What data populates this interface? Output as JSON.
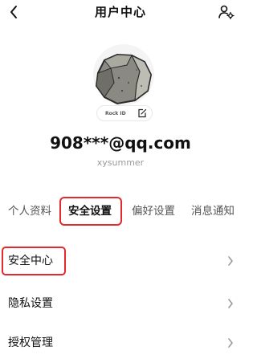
{
  "header": {
    "title": "用户中心",
    "back_icon": "chevron-left-icon",
    "action_icon": "user-settings-icon"
  },
  "profile": {
    "avatar_label": "Rock ID",
    "edit_icon": "edit-icon",
    "email": "908***@qq.com",
    "nickname": "xysummer"
  },
  "tabs": [
    {
      "label": "个人资料",
      "active": false
    },
    {
      "label": "安全设置",
      "active": true
    },
    {
      "label": "偏好设置",
      "active": false
    },
    {
      "label": "消息通知",
      "active": false
    }
  ],
  "rows": [
    {
      "label": "安全中心"
    },
    {
      "label": "隐私设置"
    },
    {
      "label": "授权管理"
    }
  ],
  "colors": {
    "highlight": "#e3292b",
    "text": "#111111",
    "muted": "#9a9a9a"
  }
}
